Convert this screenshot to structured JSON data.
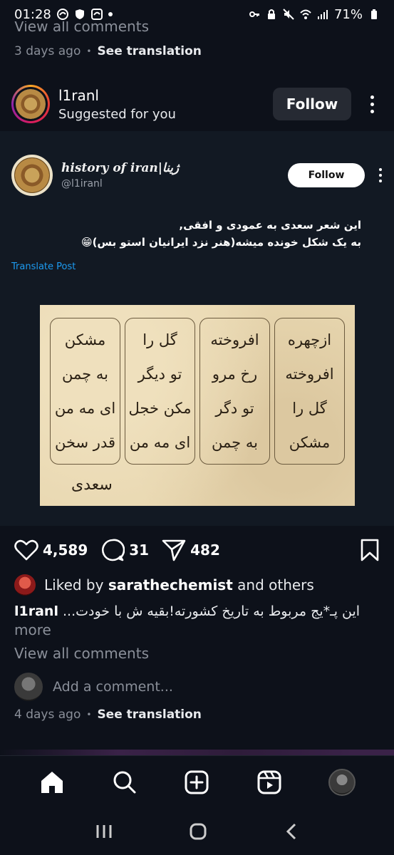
{
  "status_bar": {
    "time": "01:28",
    "battery": "71%",
    "left_icons": [
      "edge-icon",
      "shield-icon",
      "edge-icon",
      "dot-icon"
    ],
    "right_icons": [
      "key-icon",
      "lock-icon",
      "mute-icon",
      "wifi-icon",
      "signal-icon",
      "battery-icon"
    ]
  },
  "previous_post": {
    "view_all_comments": "View all comments",
    "date": "3 days ago",
    "see_translation": "See translation"
  },
  "post_header": {
    "username": "l1ranl",
    "subtitle": "Suggested for you",
    "follow_label": "Follow"
  },
  "embedded_tweet": {
    "display_name": "history of iran|ژینا",
    "handle": "@l1iranl",
    "follow_label": "Follow",
    "text_line1": "این شعر سعدی به عمودی و افقی,",
    "text_line2": "به یک شکل خونده میشه(هنر نزد ایرانیان استو بس)😁",
    "translate_label": "Translate Post",
    "poem": {
      "columns": [
        [
          "ازچهره",
          "افروخته",
          "گل را",
          "مشکن"
        ],
        [
          "افروخته",
          "رخ مرو",
          "تو دگر",
          "به چمن"
        ],
        [
          "گل را",
          "تو دیگر",
          "مکن خجل",
          "ای مه من"
        ],
        [
          "مشکن",
          "به چمن",
          "ای مه من",
          "قدر سخن"
        ]
      ],
      "signature": "سعدی"
    }
  },
  "actions": {
    "likes": "4,589",
    "comments": "31",
    "shares": "482"
  },
  "liked_by": {
    "prefix": "Liked by",
    "user": "sarathechemist",
    "suffix": "and others"
  },
  "caption": {
    "user": "l1ranl",
    "text": "این پـ*یج مربوط به تاریخ کشورته!بقیه ش با خودت...",
    "more": "more"
  },
  "comments": {
    "view_all": "View all comments",
    "add_placeholder": "Add a comment...",
    "date": "4 days ago",
    "see_translation": "See translation"
  },
  "bottom_nav": [
    "home-icon",
    "search-icon",
    "create-icon",
    "reels-icon",
    "profile-avatar"
  ],
  "colors": {
    "background": "#0d111a",
    "card": "#121923",
    "muted": "#8a8f99",
    "link": "#1d9bf0"
  }
}
